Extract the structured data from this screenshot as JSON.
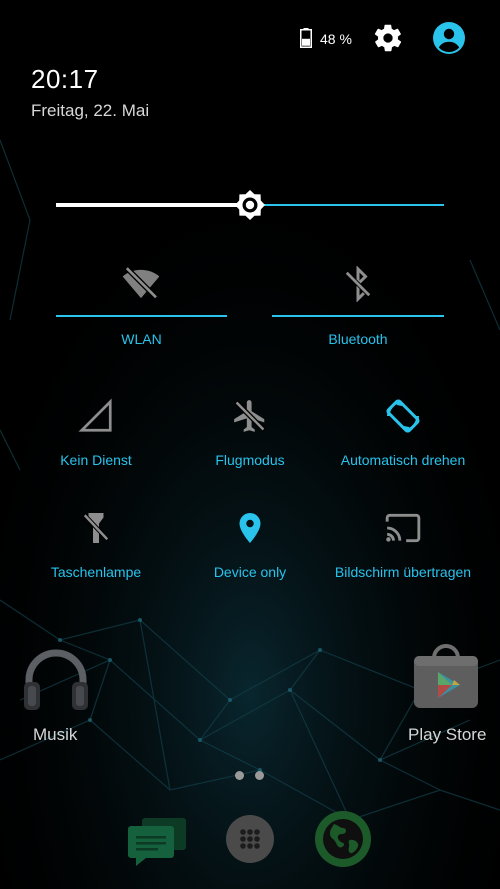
{
  "status": {
    "battery_percent": "48 %",
    "battery_level": 0.48,
    "icons": [
      "battery-icon",
      "settings-gear-icon",
      "user-account-icon"
    ]
  },
  "header": {
    "time": "20:17",
    "date": "Freitag, 22. Mai"
  },
  "brightness": {
    "level": 0.5
  },
  "toggles_wide": [
    {
      "label": "WLAN",
      "icon": "wifi-off-icon",
      "active": false
    },
    {
      "label": "Bluetooth",
      "icon": "bluetooth-off-icon",
      "active": false
    }
  ],
  "tiles": [
    {
      "label": "Kein Dienst",
      "icon": "signal-icon",
      "active": false
    },
    {
      "label": "Flugmodus",
      "icon": "airplane-off-icon",
      "active": false
    },
    {
      "label": "Automatisch drehen",
      "icon": "auto-rotate-icon",
      "active": true
    },
    {
      "label": "Taschenlampe",
      "icon": "flashlight-off-icon",
      "active": false
    },
    {
      "label": "Device only",
      "icon": "location-pin-icon",
      "active": true
    },
    {
      "label": "Bildschirm übertragen",
      "icon": "cast-screen-icon",
      "active": false
    }
  ],
  "home": {
    "apps": [
      {
        "label": "Musik",
        "icon": "headphones-icon"
      },
      {
        "label": "Play Store",
        "icon": "play-store-icon"
      }
    ],
    "dock": [
      "messaging-icon",
      "app-drawer-icon",
      "browser-globe-icon"
    ]
  },
  "colors": {
    "accent": "#29c3ec",
    "inactive_icon": "#8e8e8e",
    "background": "#000000"
  }
}
